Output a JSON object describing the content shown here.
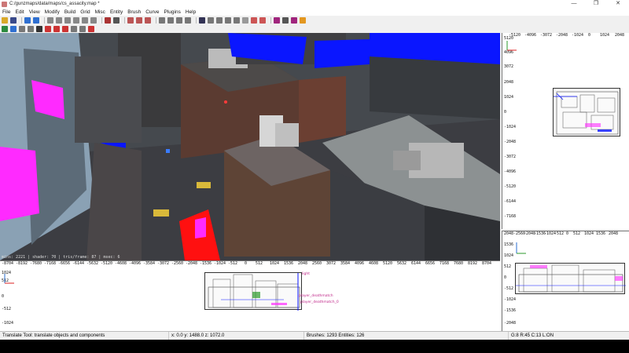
{
  "window": {
    "title": "C:/gunzmaps/data/maps/cs_assacity.map *",
    "controls": [
      "—",
      "❐",
      "✕"
    ]
  },
  "menu": [
    "File",
    "Edit",
    "View",
    "Modify",
    "Build",
    "Grid",
    "Misc",
    "Entity",
    "Brush",
    "Curve",
    "Plugins",
    "Help"
  ],
  "views": {
    "top": {
      "x_ticks": [
        "-5120",
        "-4096",
        "-3072",
        "-2048",
        "-1024",
        "0",
        "1024",
        "2048"
      ],
      "y_ticks": [
        "5120",
        "4096",
        "3072",
        "2048",
        "1024",
        "0",
        "-1024",
        "-2048",
        "-3072",
        "-4096",
        "-5120",
        "-6144",
        "-7168"
      ]
    },
    "front": {
      "x_ticks": [
        "-8704",
        "-8192",
        "-7680",
        "-7168",
        "-6656",
        "-6144",
        "-5632",
        "-5120",
        "-4608",
        "-4096",
        "-3584",
        "-3072",
        "-2560",
        "-2048",
        "-1536",
        "-1024",
        "-512",
        "0",
        "512",
        "1024",
        "1536",
        "2048",
        "2560",
        "3072",
        "3584",
        "4096",
        "4608",
        "5120",
        "5632",
        "6144",
        "6656",
        "7168",
        "7680",
        "8192",
        "8704"
      ],
      "y_ticks": [
        "1024",
        "512",
        "0",
        "-512",
        "-1024"
      ],
      "entity_labels": [
        "player_deathmatch",
        "player_deathmatch_0",
        "light"
      ]
    },
    "side": {
      "x_ticks": [
        "-2560",
        "-2048",
        "-1536",
        "-1024",
        "-512",
        "0",
        "512",
        "1024",
        "1536",
        "2048"
      ],
      "y_ticks": [
        "2048",
        "1536",
        "1024",
        "512",
        "0",
        "-512",
        "-1024",
        "-1536",
        "-2048"
      ]
    },
    "camera_info": "  mins: 2221 | shader: 70 | tris/frame: 87 | msec: 6"
  },
  "status": {
    "tool": "Translate Tool: translate objects and components",
    "coords": "x:     0.0  y:  1488.0  z:  1072.0",
    "counts": "Brushes: 1293 Entities: 126",
    "grid": "G:8  R:45  C:13  L:ON"
  },
  "colors": {
    "brush_blue": "#0a16ff",
    "brush_magenta": "#ff2aff",
    "brush_red": "#ff1010",
    "entity_pink": "#c0288a"
  }
}
